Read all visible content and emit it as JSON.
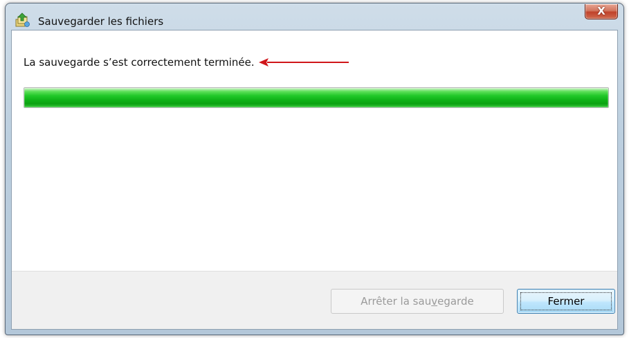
{
  "window": {
    "title": "Sauvegarder les fichiers",
    "close_glyph": "X"
  },
  "icons": {
    "app": "backup-files-icon",
    "close": "close-icon",
    "arrow": "red-arrow-left-icon"
  },
  "main": {
    "status_text": "La sauvegarde s’est correctement terminée.",
    "progress_fraction": 1.0
  },
  "buttons": {
    "stop_prefix": "Arrêter la sau",
    "stop_underlined": "v",
    "stop_suffix": "egarde",
    "close_label": "Fermer"
  },
  "colors": {
    "progress_green": "#16b51c",
    "arrow_red": "#d0161a",
    "close_red": "#c0422a"
  }
}
